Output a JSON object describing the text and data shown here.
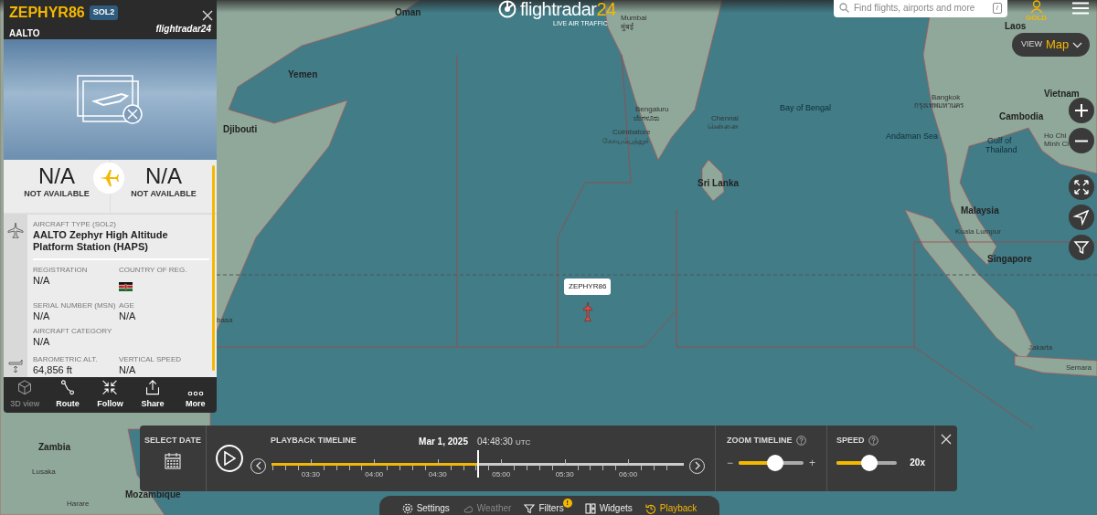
{
  "header": {
    "logo": "flightradar24",
    "tagline": "LIVE AIR TRAFFIC",
    "search": {
      "placeholder": "Find flights, airports and more",
      "shortcut": "/"
    },
    "account": "GOLD"
  },
  "view": {
    "label": "VIEW",
    "value": "Map"
  },
  "map_labels": [
    {
      "text": "Oman",
      "kind": "country"
    },
    {
      "text": "Yemen",
      "kind": "country"
    },
    {
      "text": "Djibouti",
      "kind": "country"
    },
    {
      "text": "Mumbai",
      "kind": "city"
    },
    {
      "text": "मुंबई",
      "kind": "city"
    },
    {
      "text": "Bengaluru",
      "kind": "city"
    },
    {
      "text": "ಬೆಂಗಳೂರು",
      "kind": "city"
    },
    {
      "text": "Coimbatore",
      "kind": "city"
    },
    {
      "text": "கோயம்புத்தூர்",
      "kind": "city"
    },
    {
      "text": "Chennai",
      "kind": "city"
    },
    {
      "text": "சென்னை",
      "kind": "city"
    },
    {
      "text": "Bay of Bengal",
      "kind": "sea"
    },
    {
      "text": "Sri Lanka",
      "kind": "country"
    },
    {
      "text": "Andaman Sea",
      "kind": "sea"
    },
    {
      "text": "Bangkok",
      "kind": "city"
    },
    {
      "text": "กรุงเทพมหานคร",
      "kind": "city"
    },
    {
      "text": "Laos",
      "kind": "country"
    },
    {
      "text": "Vietnam",
      "kind": "country"
    },
    {
      "text": "Cambodia",
      "kind": "country"
    },
    {
      "text": "Gulf of",
      "kind": "sea"
    },
    {
      "text": "Thailand",
      "kind": "sea"
    },
    {
      "text": "Ho Chi",
      "kind": "city"
    },
    {
      "text": "Minh Ci",
      "kind": "city"
    },
    {
      "text": "Malaysia",
      "kind": "country"
    },
    {
      "text": "Kuala Lumpur",
      "kind": "city"
    },
    {
      "text": "Singapore",
      "kind": "country"
    },
    {
      "text": "Jakarta",
      "kind": "city"
    },
    {
      "text": "Semara",
      "kind": "city"
    },
    {
      "text": "basa",
      "kind": "city"
    },
    {
      "text": "Zambia",
      "kind": "country"
    },
    {
      "text": "Lusaka",
      "kind": "city"
    },
    {
      "text": "Mozambique",
      "kind": "country"
    },
    {
      "text": "Harare",
      "kind": "city"
    }
  ],
  "flight_tag": "ZEPHYR86",
  "flight_panel": {
    "callsign": "ZEPHYR86",
    "type_code": "SOL2",
    "airline": "AALTO",
    "brand": "flightradar24",
    "origin": {
      "code": "N/A",
      "name": "NOT AVAILABLE"
    },
    "destination": {
      "code": "N/A",
      "name": "NOT AVAILABLE"
    },
    "sections": [
      {
        "kind": "aircraft",
        "type_label": "AIRCRAFT TYPE (SOL2)",
        "type_value": "AALTO Zephyr High Altitude Platform Station (HAPS)",
        "fields": [
          {
            "label": "REGISTRATION",
            "value": "N/A",
            "kind": "text"
          },
          {
            "label": "COUNTRY OF REG.",
            "kind": "flag"
          },
          {
            "label": "SERIAL NUMBER (MSN)",
            "value": "N/A",
            "kind": "text"
          },
          {
            "label": "AGE",
            "value": "N/A",
            "kind": "text"
          },
          {
            "label": "AIRCRAFT CATEGORY",
            "value": "N/A",
            "kind": "text"
          }
        ]
      },
      {
        "kind": "altitude",
        "fields": [
          {
            "label": "BAROMETRIC ALT.",
            "value": "64,856 ft",
            "kind": "text"
          },
          {
            "label": "VERTICAL SPEED",
            "value": "N/A",
            "kind": "text"
          }
        ]
      }
    ],
    "actions": [
      {
        "label": "3D view",
        "kind": "cube",
        "disabled": true
      },
      {
        "label": "Route",
        "kind": "route",
        "disabled": false
      },
      {
        "label": "Follow",
        "kind": "follow",
        "disabled": false
      },
      {
        "label": "Share",
        "kind": "share",
        "disabled": false
      },
      {
        "label": "More",
        "kind": "more",
        "disabled": false
      }
    ]
  },
  "playback": {
    "select_date": "SELECT DATE",
    "title": "PLAYBACK TIMELINE",
    "date": "Mar 1, 2025",
    "time": "04:48:30",
    "zone": "UTC",
    "level": 0.5,
    "tick_labels": [
      "03:30",
      "04:00",
      "04:30",
      "05:00",
      "05:30",
      "06:00"
    ],
    "zoom": {
      "label": "ZOOM TIMELINE",
      "minus": "−",
      "plus": "+",
      "level": 0.58
    },
    "speed": {
      "label": "SPEED",
      "value": "20x",
      "level": 0.55
    }
  },
  "bottom_nav": [
    {
      "label": "Settings",
      "kind": "settings",
      "selected": false,
      "disabled": false
    },
    {
      "label": "Weather",
      "kind": "weather",
      "selected": false,
      "disabled": true
    },
    {
      "label": "Filters",
      "kind": "filters",
      "selected": false,
      "disabled": false,
      "badge": "!"
    },
    {
      "label": "Widgets",
      "kind": "widgets",
      "selected": false,
      "disabled": false
    },
    {
      "label": "Playback",
      "kind": "playback",
      "selected": true,
      "disabled": false
    }
  ]
}
